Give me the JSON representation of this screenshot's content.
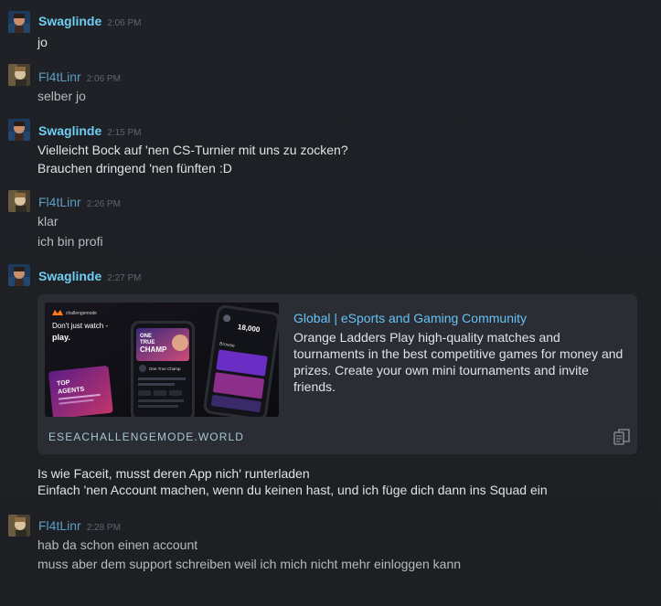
{
  "messages": [
    {
      "author": "Swaglinde",
      "time": "2:06 PM",
      "lines": [
        "jo"
      ]
    },
    {
      "author": "Fl4tLinr",
      "time": "2:06 PM",
      "lines": [
        "selber jo"
      ]
    },
    {
      "author": "Swaglinde",
      "time": "2:15 PM",
      "lines": [
        "Vielleicht Bock auf 'nen CS-Turnier mit uns zu zocken?",
        "Brauchen dringend 'nen fünften :D"
      ]
    },
    {
      "author": "Fl4tLinr",
      "time": "2:26 PM",
      "lines": [
        "klar",
        "ich bin profi"
      ]
    },
    {
      "author": "Swaglinde",
      "time": "2:27 PM",
      "lines": [
        "Is wie Faceit, musst deren App nich' runterladen",
        "Einfach 'nen Account machen, wenn du keinen hast, und ich füge dich dann ins Squad ein"
      ]
    },
    {
      "author": "Fl4tLinr",
      "time": "2:28 PM",
      "lines": [
        "hab da schon einen account",
        "muss aber dem support schreiben weil ich mich nicht mehr einloggen kann"
      ]
    }
  ],
  "embed": {
    "title": "Global | eSports and Gaming Community",
    "description": "Orange Ladders Play high-quality matches and tournaments in the best competitive games for money and prizes. Create your own mini tournaments and invite friends.",
    "url": "ESEACHALLENGEMODE.WORLD",
    "image": {
      "brand": "challengemode",
      "headline1": "Don't just watch -",
      "headline2": "play.",
      "promo1": "TOP",
      "promo2": "AGENTS",
      "promo_text": "Find Tournaments and Leaders you can play",
      "phone1_title1": "ONE",
      "phone1_title2": "TRUE",
      "phone1_title3": "CHAMP",
      "phone1_event": "One True Champ",
      "phone2_browse": "Browse",
      "phone2_amount": "18,000"
    }
  },
  "colors": {
    "author_primary": "#6dcff6",
    "author_secondary": "#5a9ec4",
    "link": "#67c1f5",
    "background": "#1e2024"
  }
}
